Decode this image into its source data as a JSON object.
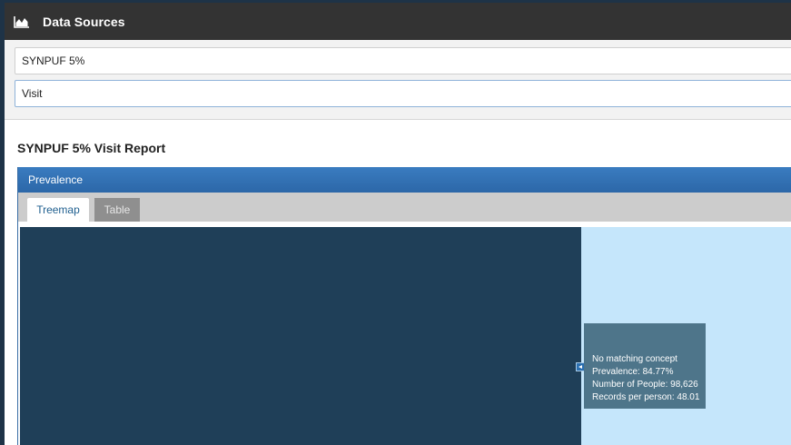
{
  "header": {
    "title": "Data Sources",
    "icon": "area-chart-icon"
  },
  "selectors": {
    "source": "SYNPUF 5%",
    "report": "Visit"
  },
  "report": {
    "title": "SYNPUF 5% Visit Report"
  },
  "panel": {
    "heading": "Prevalence",
    "tabs": [
      {
        "label": "Treemap",
        "active": true
      },
      {
        "label": "Table",
        "active": false
      }
    ]
  },
  "treemap": {
    "tooltip": {
      "line1": "No matching concept",
      "line2": "Prevalence: 84.77%",
      "line3": "Number of People: 98,626",
      "line4": "Records per person: 48.01"
    },
    "colors": {
      "dominant": "#1f3f58",
      "background": "#c5e6fb"
    }
  }
}
